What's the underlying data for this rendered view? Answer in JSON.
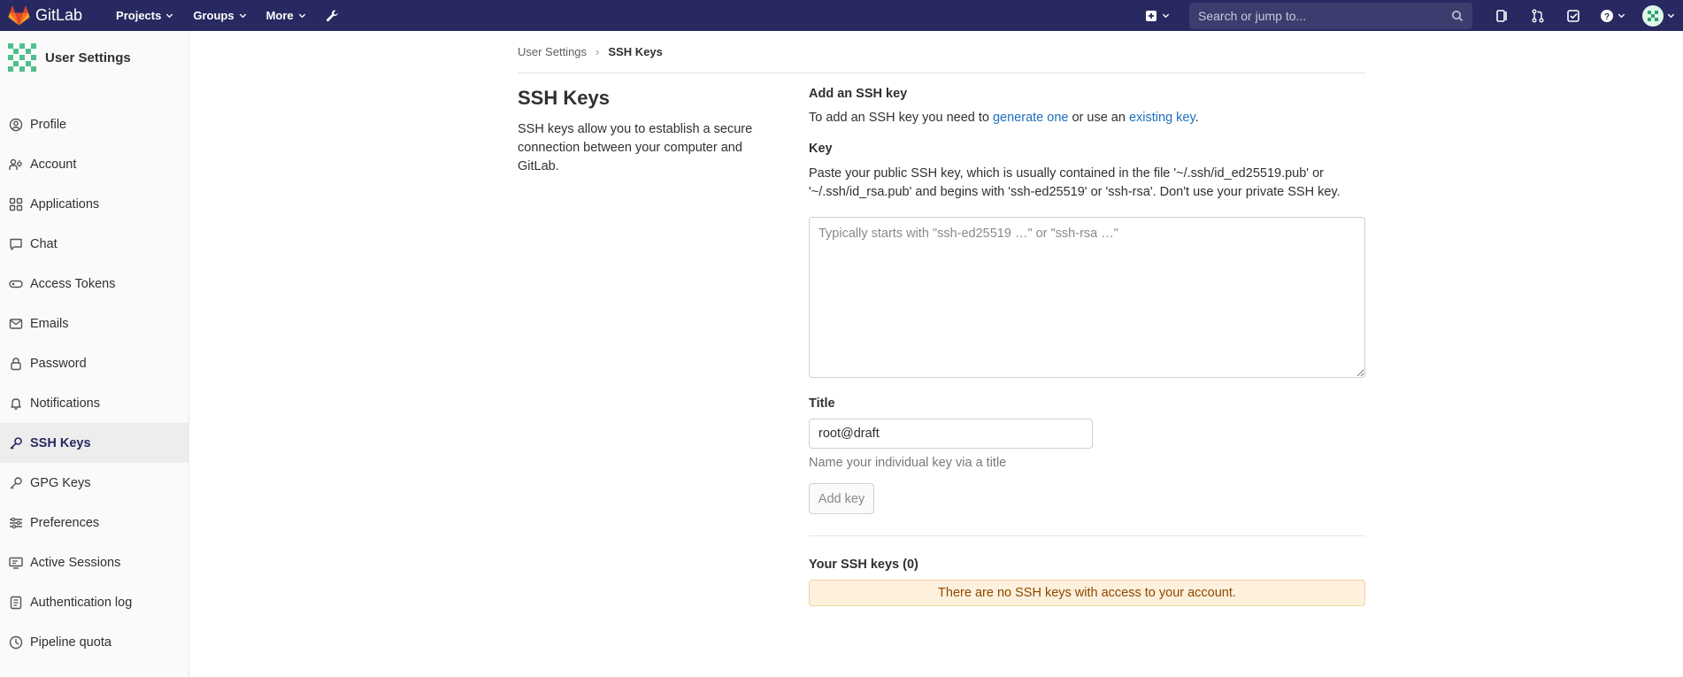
{
  "topbar": {
    "brand": "GitLab",
    "nav": [
      {
        "label": "Projects"
      },
      {
        "label": "Groups"
      },
      {
        "label": "More"
      }
    ],
    "search_placeholder": "Search or jump to..."
  },
  "sidebar": {
    "title": "User Settings",
    "items": [
      {
        "label": "Profile",
        "icon": "profile-icon"
      },
      {
        "label": "Account",
        "icon": "account-icon"
      },
      {
        "label": "Applications",
        "icon": "applications-icon"
      },
      {
        "label": "Chat",
        "icon": "chat-icon"
      },
      {
        "label": "Access Tokens",
        "icon": "token-icon"
      },
      {
        "label": "Emails",
        "icon": "mail-icon"
      },
      {
        "label": "Password",
        "icon": "lock-icon"
      },
      {
        "label": "Notifications",
        "icon": "bell-icon"
      },
      {
        "label": "SSH Keys",
        "icon": "key-icon",
        "active": true
      },
      {
        "label": "GPG Keys",
        "icon": "key-icon"
      },
      {
        "label": "Preferences",
        "icon": "preferences-icon"
      },
      {
        "label": "Active Sessions",
        "icon": "monitor-icon"
      },
      {
        "label": "Authentication log",
        "icon": "log-icon"
      },
      {
        "label": "Pipeline quota",
        "icon": "quota-icon"
      }
    ]
  },
  "breadcrumb": {
    "parent": "User Settings",
    "separator": "›",
    "current": "SSH Keys"
  },
  "intro": {
    "heading": "SSH Keys",
    "description": "SSH keys allow you to establish a secure connection between your computer and GitLab."
  },
  "form": {
    "heading": "Add an SSH key",
    "instr_prefix": "To add an SSH key you need to ",
    "link_generate": "generate one",
    "instr_middle": " or use an ",
    "link_existing": "existing key",
    "instr_suffix": ".",
    "key_label": "Key",
    "key_help": "Paste your public SSH key, which is usually contained in the file '~/.ssh/id_ed25519.pub' or '~/.ssh/id_rsa.pub' and begins with 'ssh-ed25519' or 'ssh-rsa'. Don't use your private SSH key.",
    "key_placeholder": "Typically starts with \"ssh-ed25519 …\" or \"ssh-rsa …\"",
    "title_label": "Title",
    "title_value": "root@draft",
    "title_hint": "Name your individual key via a title",
    "submit_label": "Add key"
  },
  "keys_list": {
    "heading": "Your SSH keys (0)",
    "empty_message": "There are no SSH keys with access to your account."
  }
}
